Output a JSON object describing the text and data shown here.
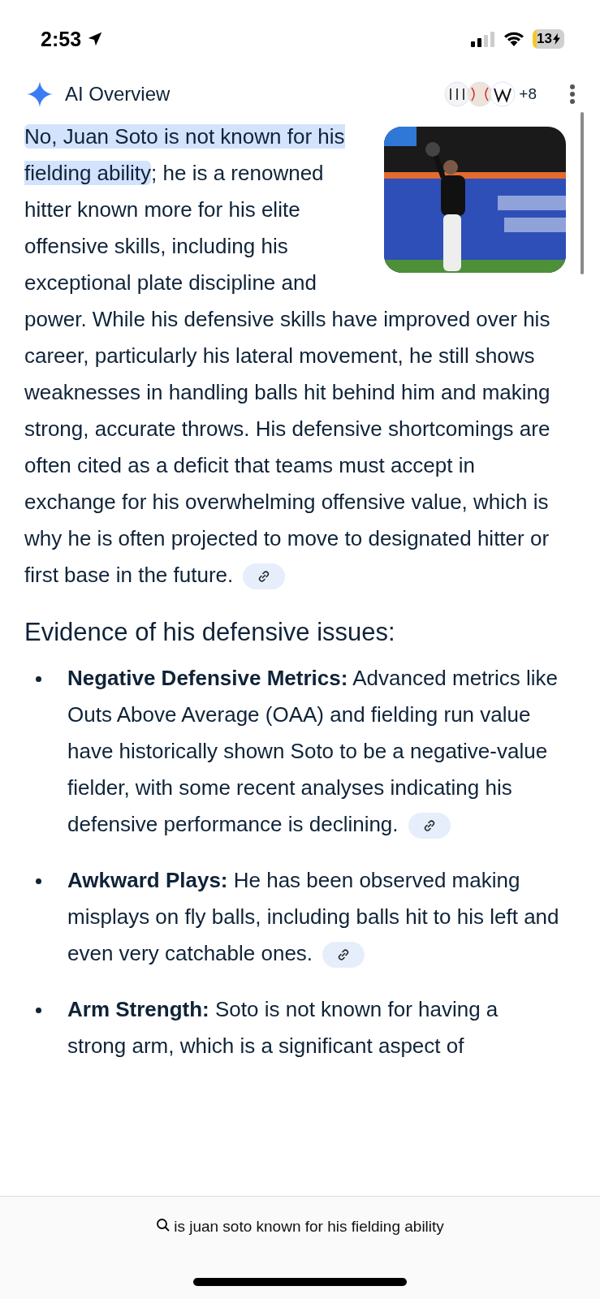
{
  "status_bar": {
    "time": "2:53",
    "battery": "13"
  },
  "header": {
    "title": "AI Overview",
    "more_sources": "+8"
  },
  "answer": {
    "highlight": "No, Juan Soto is not known for his fielding ability",
    "text": "; he is a renowned hitter known more for his elite offensive skills, including his exceptional plate discipline and power. While his defensive skills have improved over his career, particularly his lateral movement, he still shows weaknesses in handling balls hit behind him and making strong, accurate throws. His defensive shortcomings are often cited as a deficit that teams must accept in exchange for his overwhelming offensive value, which is why he is often projected to move to designated hitter or first base in the future."
  },
  "section_heading": "Evidence of his defensive issues:",
  "bullets": [
    {
      "title": "Negative Defensive Metrics:",
      "text": " Advanced metrics like Outs Above Average (OAA) and fielding run value have historically shown Soto to be a negative-value fielder, with some recent analyses indicating his defensive performance is declining.",
      "link": true
    },
    {
      "title": "Awkward Plays:",
      "text": " He has been observed making misplays on fly balls, including balls hit to his left and even very catchable ones.",
      "link": true
    },
    {
      "title": "Arm Strength:",
      "text": " Soto is not known for having a strong arm, which is a significant aspect of",
      "link": false
    }
  ],
  "search_bar": {
    "query": "is juan soto known for his fielding ability"
  }
}
